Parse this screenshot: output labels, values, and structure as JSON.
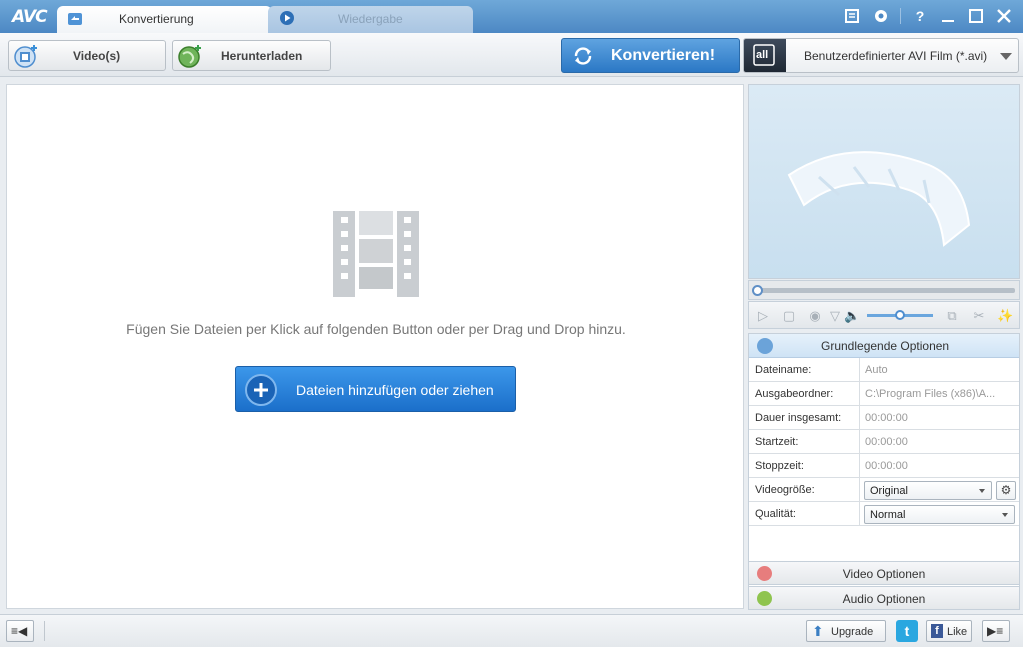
{
  "app": {
    "logo": "AVC"
  },
  "tabs": [
    {
      "label": "Konvertierung",
      "active": true
    },
    {
      "label": "Wiedergabe",
      "active": false
    }
  ],
  "window_controls": {
    "help": "?"
  },
  "toolbar": {
    "add_video_label": "Video(s)",
    "download_label": "Herunterladen",
    "convert_label": "Konvertieren!",
    "profile_label": "Benutzerdefinierter AVI Film (*.avi)",
    "profile_icon_text": "all"
  },
  "main": {
    "hint": "Fügen Sie Dateien per Klick auf folgenden Button oder per Drag und Drop hinzu.",
    "add_button_label": "Dateien hinzufügen oder ziehen"
  },
  "player": {
    "seek_progress": 0.0
  },
  "options": {
    "header": "Grundlegende Optionen",
    "rows": [
      {
        "key": "Dateiname:",
        "value": "Auto"
      },
      {
        "key": "Ausgabeordner:",
        "value": "C:\\Program Files (x86)\\A..."
      },
      {
        "key": "Dauer insgesamt:",
        "value": "00:00:00"
      },
      {
        "key": "Startzeit:",
        "value": "00:00:00"
      },
      {
        "key": "Stoppzeit:",
        "value": "00:00:00"
      }
    ],
    "video_size": {
      "key": "Videogröße:",
      "value": "Original"
    },
    "quality": {
      "key": "Qualität:",
      "value": "Normal"
    },
    "video_options_label": "Video Optionen",
    "audio_options_label": "Audio Optionen"
  },
  "statusbar": {
    "upgrade_label": "Upgrade",
    "like_label": "Like"
  },
  "colors": {
    "titlebar": "#4c88c4",
    "convert_button": "#2b78c5",
    "add_files_button": "#1b6fca",
    "twitter": "#2aa7e0",
    "facebook": "#3b5998"
  }
}
